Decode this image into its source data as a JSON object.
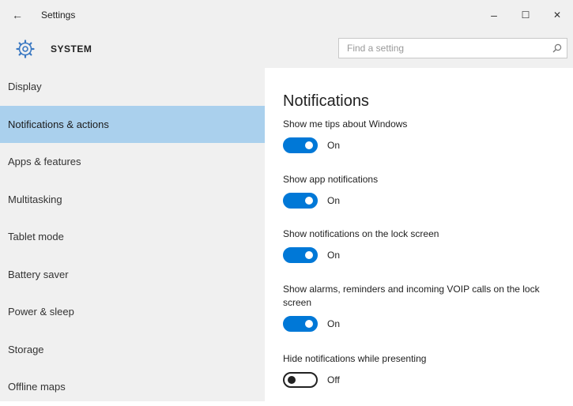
{
  "window": {
    "title": "Settings",
    "back_glyph": "←",
    "minimize_glyph": "–",
    "maximize_glyph": "☐",
    "close_glyph": "✕"
  },
  "header": {
    "icon": "gear-icon",
    "title": "SYSTEM",
    "search_placeholder": "Find a setting",
    "search_value": ""
  },
  "sidebar": {
    "selected_index": 1,
    "items": [
      {
        "label": "Display"
      },
      {
        "label": "Notifications & actions"
      },
      {
        "label": "Apps & features"
      },
      {
        "label": "Multitasking"
      },
      {
        "label": "Tablet mode"
      },
      {
        "label": "Battery saver"
      },
      {
        "label": "Power & sleep"
      },
      {
        "label": "Storage"
      },
      {
        "label": "Offline maps"
      }
    ]
  },
  "content": {
    "section_title": "Notifications",
    "settings": [
      {
        "label": "Show me tips about Windows",
        "state": "On",
        "on": true
      },
      {
        "label": "Show app notifications",
        "state": "On",
        "on": true
      },
      {
        "label": "Show notifications on the lock screen",
        "state": "On",
        "on": true
      },
      {
        "label": "Show alarms, reminders and incoming VOIP calls on the lock screen",
        "state": "On",
        "on": true
      },
      {
        "label": "Hide notifications while presenting",
        "state": "Off",
        "on": false
      }
    ]
  },
  "colors": {
    "accent": "#0078d7",
    "selected_nav": "#aad0ed",
    "chrome": "#f0f0f0"
  }
}
